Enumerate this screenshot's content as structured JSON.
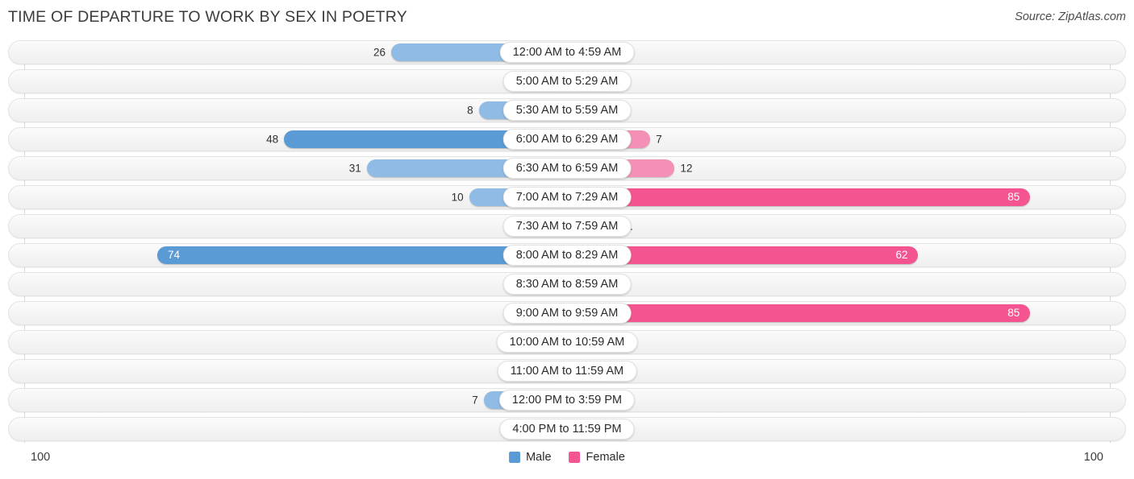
{
  "header": {
    "title": "TIME OF DEPARTURE TO WORK BY SEX IN POETRY",
    "source": "Source: ZipAtlas.com"
  },
  "legend": {
    "male_label": "Male",
    "female_label": "Female"
  },
  "axis": {
    "left_end": "100",
    "right_end": "100"
  },
  "colors": {
    "male_strong": "#5b9bd5",
    "male_light": "#a8c8ea",
    "female_strong": "#f4548f",
    "female_light": "#f5a8c3",
    "row_bg": "#f4f4f4",
    "text": "#2f2f33"
  },
  "chart_data": {
    "type": "bar",
    "title": "TIME OF DEPARTURE TO WORK BY SEX IN POETRY",
    "orientation": "horizontal-diverging",
    "xlabel": "",
    "ylabel": "",
    "xlim": [
      100,
      100
    ],
    "grid": true,
    "legend_position": "bottom-center",
    "categories": [
      "12:00 AM to 4:59 AM",
      "5:00 AM to 5:29 AM",
      "5:30 AM to 5:59 AM",
      "6:00 AM to 6:29 AM",
      "6:30 AM to 6:59 AM",
      "7:00 AM to 7:29 AM",
      "7:30 AM to 7:59 AM",
      "8:00 AM to 8:29 AM",
      "8:30 AM to 8:59 AM",
      "9:00 AM to 9:59 AM",
      "10:00 AM to 10:59 AM",
      "11:00 AM to 11:59 AM",
      "12:00 PM to 3:59 PM",
      "4:00 PM to 11:59 PM"
    ],
    "series": [
      {
        "name": "Male",
        "side": "left",
        "values": [
          26,
          0,
          8,
          48,
          31,
          10,
          0,
          74,
          0,
          0,
          0,
          0,
          7,
          0
        ]
      },
      {
        "name": "Female",
        "side": "right",
        "values": [
          0,
          0,
          0,
          7,
          12,
          85,
          1,
          62,
          0,
          85,
          0,
          0,
          0,
          0
        ]
      }
    ]
  }
}
